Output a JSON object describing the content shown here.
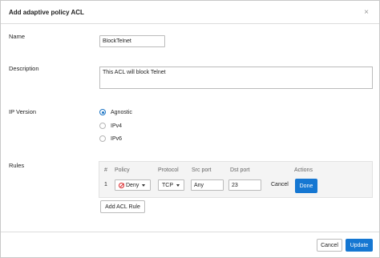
{
  "dialog": {
    "title": "Add adaptive policy ACL",
    "close_glyph": "×"
  },
  "form": {
    "name": {
      "label": "Name",
      "value": "BlockTelnet"
    },
    "description": {
      "label": "Description",
      "value": "This ACL will block Telnet"
    },
    "ip_version": {
      "label": "IP Version",
      "options": [
        {
          "label": "Agnostic",
          "selected": true
        },
        {
          "label": "IPv4",
          "selected": false
        },
        {
          "label": "IPv6",
          "selected": false
        }
      ]
    },
    "rules": {
      "label": "Rules",
      "columns": [
        "#",
        "Policy",
        "Protocol",
        "Src port",
        "Dst port",
        "Actions"
      ],
      "rows": [
        {
          "index": "1",
          "policy": "Deny",
          "protocol": "TCP",
          "src_port": "Any",
          "dst_port": "23",
          "cancel_label": "Cancel",
          "done_label": "Done"
        }
      ],
      "add_button_label": "Add ACL Rule"
    }
  },
  "footer": {
    "cancel_label": "Cancel",
    "update_label": "Update"
  },
  "colors": {
    "primary": "#1577d2",
    "deny": "#d9262a",
    "radio_selected": "#1a73c4"
  },
  "icons": {
    "close": "close-icon",
    "deny": "deny-icon",
    "caret": "chevron-down-icon"
  }
}
